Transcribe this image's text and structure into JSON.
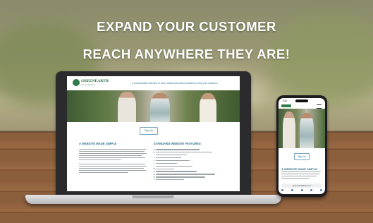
{
  "banner": {
    "line1": "EXPAND YOUR CUSTOMER",
    "line2": "REACH ANYWHERE THEY ARE!"
  },
  "laptop_site": {
    "logo_name": "GREENEARTH",
    "logo_sub": "CLEANING",
    "tagline": "A customizable selection of web, mobile and search solutions to help your business",
    "signup_button": "Sign Up",
    "left_heading": "A WEBSITE MADE SIMPLE",
    "right_heading": "STANDARD WEBSITE FEATURES"
  },
  "phone_site": {
    "status_time": "9:41",
    "signup_button": "Sign Up",
    "heading": "A WEBSITE MADE SIMPLE",
    "url": "greenearthfacts.com"
  },
  "icons": [
    "logo-icon",
    "menu-icon"
  ]
}
